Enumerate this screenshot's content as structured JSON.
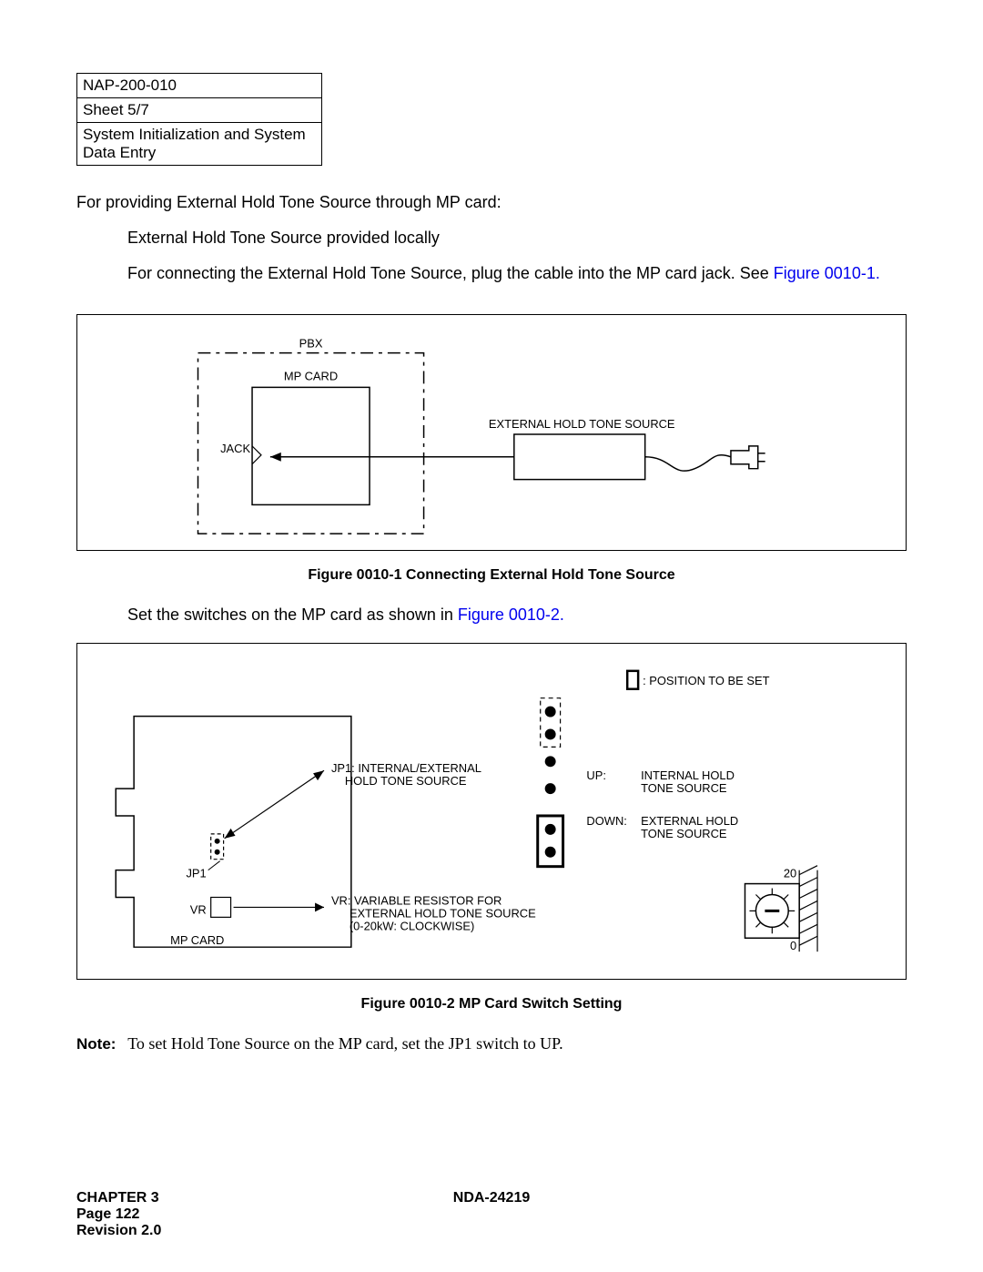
{
  "info_table": {
    "row1": "NAP-200-010",
    "row2": "Sheet 5/7",
    "row3": "System Initialization and System Data Entry"
  },
  "para1": "For providing External Hold Tone Source through MP card:",
  "para2": "External Hold Tone Source provided locally",
  "para3_a": "For connecting the External Hold Tone Source, plug the cable into the MP card jack. See ",
  "para3_link": "Figure 0010-1.",
  "figure1": {
    "caption": "Figure 0010-1   Connecting External Hold Tone Source",
    "labels": {
      "pbx": "PBX",
      "mp_card": "MP CARD",
      "jack": "JACK",
      "ext_source": "EXTERNAL HOLD TONE SOURCE"
    }
  },
  "para4_a": "Set the switches on the MP card as shown in ",
  "para4_link": "Figure 0010-2.",
  "figure2": {
    "caption": "Figure 0010-2   MP Card Switch Setting",
    "labels": {
      "legend": ": POSITION TO BE SET",
      "jp1_desc_l1": "JP1: INTERNAL/EXTERNAL",
      "jp1_desc_l2": "HOLD TONE SOURCE",
      "up_l1": "INTERNAL HOLD",
      "up_l2": "TONE SOURCE",
      "up_label": "UP:",
      "down_l1": "EXTERNAL HOLD",
      "down_l2": "TONE SOURCE",
      "down_label": "DOWN:",
      "vr_desc_l1": "VR: VARIABLE RESISTOR FOR",
      "vr_desc_l2": "EXTERNAL HOLD TONE SOURCE",
      "vr_desc_l3": "(0-20kW: CLOCKWISE)",
      "jp1": "JP1",
      "vr": "VR",
      "mp_card": "MP CARD",
      "twenty": "20",
      "zero": "0"
    }
  },
  "note": {
    "label": "Note:",
    "text": "To set Hold Tone Source on the MP card, set the JP1 switch to UP."
  },
  "footer": {
    "chapter": "CHAPTER 3",
    "page": "Page 122",
    "revision": "Revision 2.0",
    "doc": "NDA-24219"
  }
}
